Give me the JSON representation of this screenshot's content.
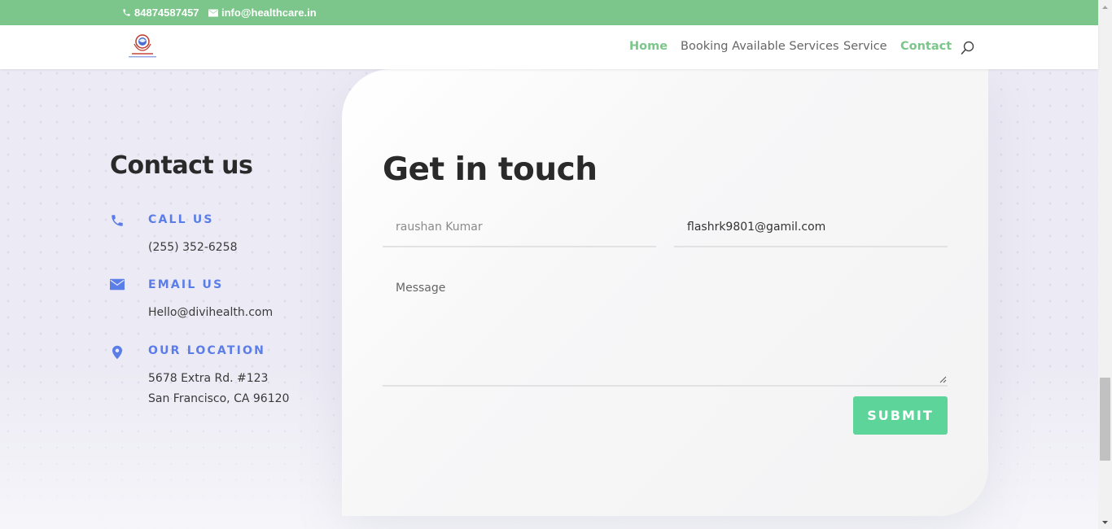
{
  "topbar": {
    "phone": "84874587457",
    "email": "info@healthcare.in",
    "bg_color": "#7cc68b"
  },
  "nav": {
    "items": [
      {
        "label": "Home",
        "active": true
      },
      {
        "label": "Booking Available Services",
        "active": false
      },
      {
        "label": "Service",
        "active": false
      },
      {
        "label": "Contact",
        "active": true
      }
    ]
  },
  "contact": {
    "title": "Contact us",
    "call": {
      "label": "CALL US",
      "value": "(255) 352-6258",
      "icon": "phone-icon"
    },
    "email": {
      "label": "EMAIL US",
      "value": "Hello@divihealth.com",
      "icon": "envelope-icon"
    },
    "location": {
      "label": "OUR LOCATION",
      "line1": "5678 Extra Rd. #123",
      "line2": "San Francisco, CA 96120",
      "icon": "map-pin-icon"
    }
  },
  "form": {
    "title": "Get in touch",
    "name_value": "raushan Kumar",
    "email_value": "flashrk9801@gamil.com",
    "message_placeholder": "Message",
    "submit_label": "SUBMIT",
    "submit_color": "#5dd49a"
  },
  "colors": {
    "accent_blue": "#5a7de8",
    "accent_green": "#7cc68b"
  }
}
